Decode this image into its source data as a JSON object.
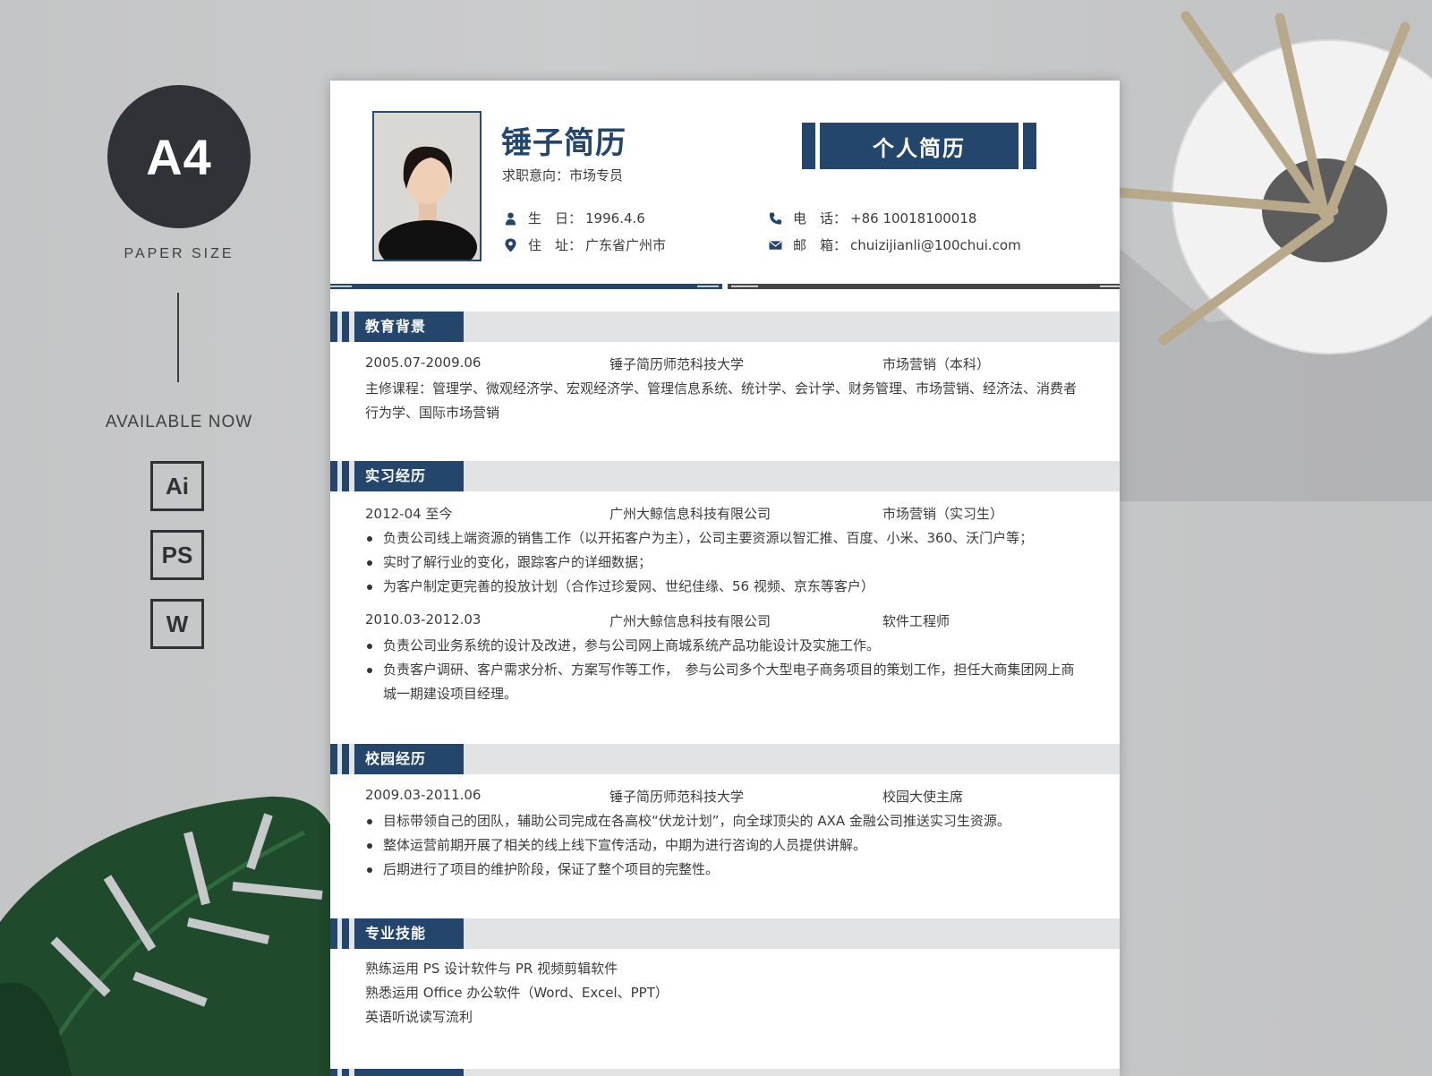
{
  "showcase": {
    "paper_badge": "A4",
    "paper_size": "PAPER SIZE",
    "available": "AVAILABLE NOW",
    "formats": [
      "Ai",
      "PS",
      "W"
    ]
  },
  "resume": {
    "name": "锤子简历",
    "intent": "求职意向：市场专员",
    "doc_title": "个人简历",
    "info": {
      "birth": {
        "icon": "person-icon",
        "label": "生　日：",
        "value": "1996.4.6"
      },
      "address": {
        "icon": "location-pin-icon",
        "label": "住　址：",
        "value": "广东省广州市"
      },
      "phone": {
        "icon": "phone-icon",
        "label": "电　话：",
        "value": "+86 10018100018"
      },
      "email": {
        "icon": "envelope-icon",
        "label": "邮　箱：",
        "value": "chuizijianli@100chui.com"
      }
    },
    "sections": {
      "education": {
        "title": "教育背景",
        "entry": {
          "date": "2005.07-2009.06",
          "org": "锤子简历师范科技大学",
          "role": "市场营销（本科）"
        },
        "courses": "主修课程：管理学、微观经济学、宏观经济学、管理信息系统、统计学、会计学、财务管理、市场营销、经济法、消费者行为学、国际市场营销"
      },
      "internship": {
        "title": "实习经历",
        "entries": [
          {
            "date": "2012-04 至今",
            "org": "广州大鲸信息科技有限公司",
            "role": "市场营销（实习生）",
            "bullets": [
              "负责公司线上端资源的销售工作（以开拓客户为主），公司主要资源以智汇推、百度、小米、360、沃门户等；",
              "实时了解行业的变化，跟踪客户的详细数据；",
              "为客户制定更完善的投放计划（合作过珍爱网、世纪佳缘、56 视频、京东等客户）"
            ]
          },
          {
            "date": "2010.03-2012.03",
            "org": "广州大鲸信息科技有限公司",
            "role": "软件工程师",
            "bullets": [
              "负责公司业务系统的设计及改进，参与公司网上商城系统产品功能设计及实施工作。",
              "负责客户调研、客户需求分析、方案写作等工作，　参与公司多个大型电子商务项目的策划工作，担任大商集团网上商城一期建设项目经理。"
            ]
          }
        ]
      },
      "campus": {
        "title": "校园经历",
        "entry": {
          "date": "2009.03-2011.06",
          "org": "锤子简历师范科技大学",
          "role": "校园大使主席"
        },
        "bullets": [
          "目标带领自己的团队，辅助公司完成在各高校“伏龙计划”，向全球顶尖的 AXA 金融公司推送实习生资源。",
          "整体运营前期开展了相关的线上线下宣传活动，中期为进行咨询的人员提供讲解。",
          "后期进行了项目的维护阶段，保证了整个项目的完整性。"
        ]
      },
      "skills": {
        "title": "专业技能",
        "lines": [
          "熟练运用 PS 设计软件与 PR 视频剪辑软件",
          "熟悉运用 Office 办公软件（Word、Excel、PPT）",
          "英语听说读写流利"
        ]
      }
    }
  },
  "colors": {
    "accent": "#24466d",
    "section_strip": "#e2e3e4",
    "dark_badge": "#2f3236",
    "divider_dark": "#444444"
  }
}
